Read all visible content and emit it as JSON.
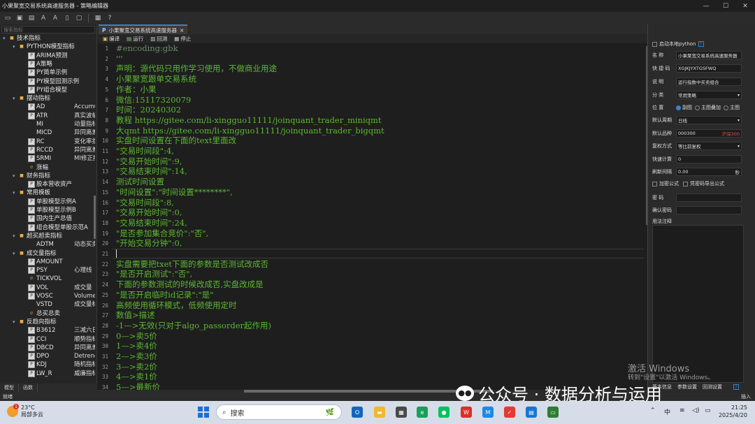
{
  "window": {
    "title": "小果聚宽交易系统高速服务器 - 策略编辑器",
    "controls": [
      "—",
      "☐",
      "✕"
    ]
  },
  "left_panel": {
    "search_placeholder": "搜索指标",
    "tree": [
      {
        "level": 0,
        "type": "folder",
        "label": "技术指标"
      },
      {
        "level": 1,
        "type": "folder",
        "label": "PYTHON模型指标"
      },
      {
        "level": 2,
        "type": "doc",
        "label": "ARIMA预测"
      },
      {
        "level": 2,
        "type": "doc",
        "label": "A策略"
      },
      {
        "level": 2,
        "type": "doc",
        "label": "PY简单示例"
      },
      {
        "level": 2,
        "type": "doc",
        "label": "PY模型回测示例"
      },
      {
        "level": 2,
        "type": "doc",
        "label": "PY组合模型"
      },
      {
        "level": 1,
        "type": "folder",
        "label": "摆动指标"
      },
      {
        "level": 2,
        "type": "doc",
        "label": "AD",
        "desc": "Accumulat"
      },
      {
        "level": 2,
        "type": "doc",
        "label": "ATR",
        "desc": "真实波幅"
      },
      {
        "level": 2,
        "type": "none",
        "label": "MI",
        "desc": "动量指标"
      },
      {
        "level": 2,
        "type": "none",
        "label": "MICD",
        "desc": "异同离差动"
      },
      {
        "level": 2,
        "type": "doc",
        "label": "RC",
        "desc": "变化率指数"
      },
      {
        "level": 2,
        "type": "doc",
        "label": "RCCD",
        "desc": "异同离差"
      },
      {
        "level": 2,
        "type": "doc",
        "label": "SRMI",
        "desc": "MI修正指"
      },
      {
        "level": 2,
        "type": "orange",
        "label": "涨幅"
      },
      {
        "level": 1,
        "type": "folder",
        "label": "财务指标"
      },
      {
        "level": 2,
        "type": "doc",
        "label": "股本营收资产"
      },
      {
        "level": 1,
        "type": "folder",
        "label": "常用模板"
      },
      {
        "level": 2,
        "type": "doc",
        "label": "单股模型示例A"
      },
      {
        "level": 2,
        "type": "doc",
        "label": "单股模型示例B"
      },
      {
        "level": 2,
        "type": "doc",
        "label": "国内生产总值"
      },
      {
        "level": 2,
        "type": "doc",
        "label": "组合模型单股示范A"
      },
      {
        "level": 1,
        "type": "folder",
        "label": "超买超卖指标"
      },
      {
        "level": 2,
        "type": "none",
        "label": "ADTM",
        "desc": "动态买卖"
      },
      {
        "level": 1,
        "type": "folder",
        "label": "成交量指标"
      },
      {
        "level": 2,
        "type": "doc",
        "label": "AMOUNT"
      },
      {
        "level": 2,
        "type": "doc",
        "label": "PSY",
        "desc": "心理线"
      },
      {
        "level": 2,
        "type": "orange",
        "label": "TICKVOL"
      },
      {
        "level": 2,
        "type": "doc",
        "label": "VOL",
        "desc": "成交量"
      },
      {
        "level": 2,
        "type": "doc",
        "label": "VOSC",
        "desc": "Volume"
      },
      {
        "level": 2,
        "type": "none",
        "label": "VSTD",
        "desc": "成交量标准"
      },
      {
        "level": 2,
        "type": "orange",
        "label": "总买总卖"
      },
      {
        "level": 1,
        "type": "folder",
        "label": "反趋向指标"
      },
      {
        "level": 2,
        "type": "doc",
        "label": "B3612",
        "desc": "三减六日"
      },
      {
        "level": 2,
        "type": "doc",
        "label": "CCI",
        "desc": "顺势指标"
      },
      {
        "level": 2,
        "type": "doc",
        "label": "DBCD",
        "desc": "异同离差"
      },
      {
        "level": 2,
        "type": "doc",
        "label": "DPO",
        "desc": "Detrende"
      },
      {
        "level": 2,
        "type": "doc",
        "label": "KDJ",
        "desc": "随机指标"
      },
      {
        "level": 2,
        "type": "doc",
        "label": "LW_R",
        "desc": "威廉指标"
      }
    ],
    "tabs": [
      "模型",
      "函数"
    ]
  },
  "editor": {
    "tab_label": "小果聚宽交易系统高速服务器",
    "toolbar": [
      {
        "icon": "compile-icon",
        "label": "编译"
      },
      {
        "icon": "run-icon",
        "label": "运行"
      },
      {
        "icon": "backtest-icon",
        "label": "回测"
      },
      {
        "icon": "stop-icon",
        "label": "停止"
      }
    ],
    "lines": [
      "#encoding:gbk",
      "'''",
      "声明：源代码只用作学习使用，不做商业用途",
      "小果聚宽跟单交易系统",
      "作者：小果",
      "微信:15117320079",
      "时间：20240302",
      "教程 https://gitee.com/li-xingguo11111/joinquant_trader_miniqmt",
      "大qmt https://gitee.com/li-xingguo11111/joinquant_trader_bigqmt",
      "实盘时间设置在下面的text里面改",
      "\"交易时间段\":4,",
      "\"交易开始时间\":9,",
      "\"交易结束时间\":14,",
      "测试时间设置",
      "\"时间设置\":\"时间设置********\",",
      "\"交易时间段\":8,",
      "\"交易开始时间\":0,",
      "\"交易结束时间\":24,",
      "\"是否参加集合竞价\":\"否\",",
      "\"开始交易分钟\":0,",
      "",
      "实盘需要把txet下面的参数是否测试改成否",
      "\"是否开启测试\":\"否\",",
      "下面的参数测试的时候改成否,实盘改成是",
      "\"是否开启临时id记录\":\"是\"",
      "高频使用循环模式，低频使用定时",
      "数值>描述",
      "-1—>无效(只对于algo_passorder起作用)",
      "0—>卖5价",
      "1—>卖4价",
      "2—>卖3价",
      "3—>卖2价",
      "4—>卖1价",
      "5—>最新价"
    ]
  },
  "right_panel": {
    "top_checkbox": "启动本地python",
    "name_label": "名    称",
    "name_value": "小果聚宽交易系统高速服务器",
    "code_label": "快 捷 码",
    "code_value": "XGJKJYXTGSFWQ",
    "desc_label": "说    明",
    "desc_value": "运行指数中买卖组合",
    "cat_label": "分    类",
    "cat_value": "常用策略",
    "pos_label": "位    置",
    "pos_options": [
      "副图",
      "主图叠加",
      "主图"
    ],
    "period_label": "默认周期",
    "period_value": "日线",
    "stock_label": "默认品种",
    "stock_value": "000300",
    "stock_extra": "沪深300",
    "adjust_label": "复权方式",
    "adjust_value": "等比前复权",
    "fast_label": "快速计算",
    "fast_value": "0",
    "refresh_label": "刷新间隔",
    "refresh_value": "0.00",
    "refresh_unit": "秒",
    "encrypt_label": "加密公式",
    "export_label": "凭密码导出公式",
    "pwd_label": "密    码",
    "confirm_label": "确认密码",
    "notes_label": "用法注释",
    "bottom_tabs": [
      "基本信息",
      "参数设置",
      "回测设置"
    ]
  },
  "status": {
    "left": "就绪",
    "right": "插入"
  },
  "watermark": {
    "line1": "激活 Windows",
    "line2": "转到\"设置\"以激活 Windows。"
  },
  "wechat_overlay": "公众号 · 数据分析与运用",
  "taskbar": {
    "weather_temp": "23°C",
    "weather_desc": "局部多云",
    "badge": "1",
    "search_text": "搜索",
    "time": "21:25",
    "date": "2025/4/20",
    "ime": "中",
    "colors": {
      "start": "#1f6fd1",
      "accent": "#3b82c4"
    }
  }
}
